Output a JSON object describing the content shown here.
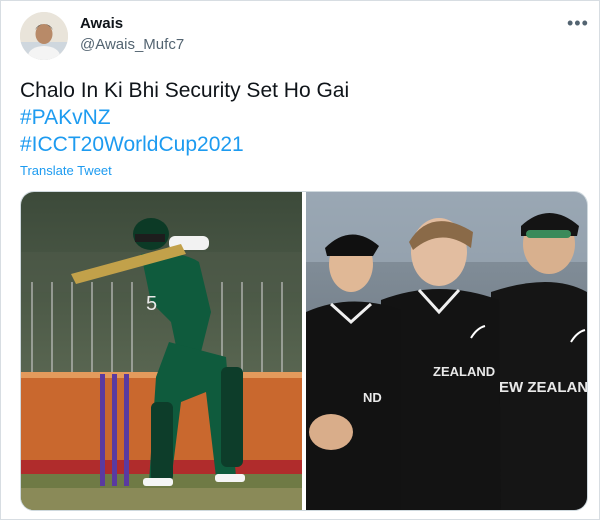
{
  "tweet": {
    "author_name": "Awais",
    "author_handle": "@Awais_Mufc7",
    "text_line_1": "Chalo In Ki Bhi Security Set Ho Gai",
    "hashtag_1": "#PAKvNZ",
    "hashtag_2": "#ICCT20WorldCup2021",
    "translate_label": "Translate Tweet",
    "more_icon": "more-icon",
    "more_glyph": "•••"
  },
  "media": {
    "left_image": "pakistan-batsman-image",
    "right_image": "new-zealand-team-image",
    "jersey_text_1": "ZEALAND",
    "jersey_text_2": "EW ZEALAND",
    "jersey_text_3": "ND",
    "jersey_number": "5"
  },
  "colors": {
    "link": "#1d9bf0",
    "text": "#0f1419",
    "muted": "#536471",
    "border": "#cfd9de"
  }
}
